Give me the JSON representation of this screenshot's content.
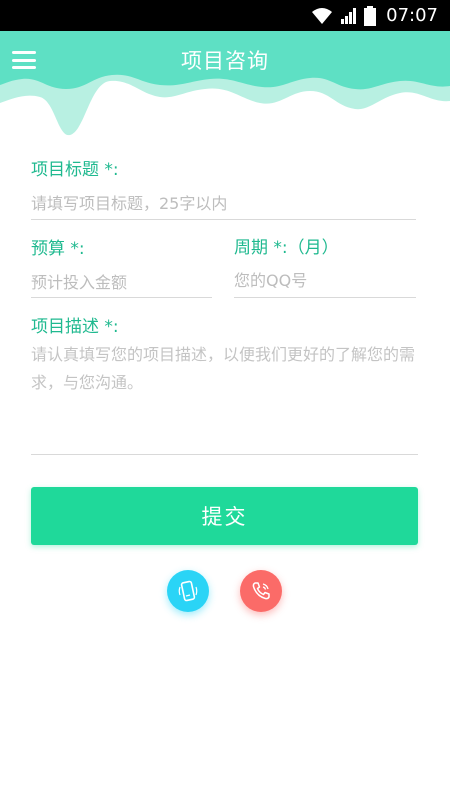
{
  "status_bar": {
    "time": "07:07"
  },
  "header": {
    "title": "项目咨询"
  },
  "form": {
    "project_title": {
      "label": "项目标题 *:",
      "placeholder": "请填写项目标题，25字以内",
      "value": ""
    },
    "budget": {
      "label": "预算 *:",
      "placeholder": "预计投入金额",
      "value": ""
    },
    "period": {
      "label": "周期 *:（月）",
      "placeholder": "您的QQ号",
      "value": ""
    },
    "description": {
      "label": "项目描述 *:",
      "placeholder": "请认真填写您的项目描述，以便我们更好的了解您的需求，与您沟通。",
      "value": ""
    },
    "submit_label": "提交"
  },
  "icons": {
    "menu": "hamburger-menu-icon",
    "mobile": "mobile-phone-icon",
    "phone": "phone-call-icon"
  },
  "colors": {
    "header": "#5ee0c4",
    "accent_text": "#1fb98f",
    "submit": "#1fd99a",
    "mobile_button": "#2ad4f6",
    "phone_button": "#fb6b68"
  }
}
